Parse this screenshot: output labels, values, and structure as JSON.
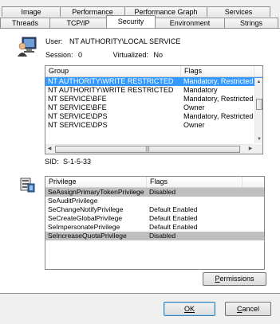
{
  "tabs": {
    "row1": [
      "Image",
      "Performance",
      "Performance Graph",
      "Services"
    ],
    "row2": [
      "Threads",
      "TCP/IP",
      "Security",
      "Environment",
      "Strings"
    ],
    "active": "Security"
  },
  "user": {
    "label": "User:",
    "value": "NT AUTHORITY\\LOCAL SERVICE",
    "session_label": "Session:",
    "session_value": "0",
    "virtualized_label": "Virtualized:",
    "virtualized_value": "No"
  },
  "groups": {
    "columns": [
      "Group",
      "Flags"
    ],
    "rows": [
      {
        "group": "NT AUTHORITY\\WRITE RESTRICTED",
        "flags": "Mandatory, Restricted",
        "selected": true
      },
      {
        "group": "NT AUTHORITY\\WRITE RESTRICTED",
        "flags": "Mandatory",
        "selected": false
      },
      {
        "group": "NT SERVICE\\BFE",
        "flags": "Mandatory, Restricted",
        "selected": false
      },
      {
        "group": "NT SERVICE\\BFE",
        "flags": "Owner",
        "selected": false
      },
      {
        "group": "NT SERVICE\\DPS",
        "flags": "Mandatory, Restricted",
        "selected": false
      },
      {
        "group": "NT SERVICE\\DPS",
        "flags": "Owner",
        "selected": false
      }
    ]
  },
  "sid": {
    "label": "SID:",
    "value": "S-1-5-33"
  },
  "privileges": {
    "columns": [
      "Privilege",
      "Flags"
    ],
    "rows": [
      {
        "privilege": "SeAssignPrimaryTokenPrivilege",
        "flags": "Disabled",
        "highlight": true
      },
      {
        "privilege": "SeAuditPrivilege",
        "flags": "",
        "highlight": false
      },
      {
        "privilege": "SeChangeNotifyPrivilege",
        "flags": "Default Enabled",
        "highlight": false
      },
      {
        "privilege": "SeCreateGlobalPrivilege",
        "flags": "Default Enabled",
        "highlight": false
      },
      {
        "privilege": "SeImpersonatePrivilege",
        "flags": "Default Enabled",
        "highlight": false
      },
      {
        "privilege": "SeIncreaseQuotaPrivilege",
        "flags": "Disabled",
        "highlight": true
      }
    ]
  },
  "buttons": {
    "permissions": "Permissions",
    "ok": "OK",
    "cancel": "Cancel"
  },
  "icons": {
    "user": "user-monitor-icon",
    "privileges": "privilege-shield-icon"
  },
  "colors": {
    "selection": "#3399ff",
    "disabled_row": "#bfbfbf",
    "default_button_border": "#3c7fb1"
  }
}
